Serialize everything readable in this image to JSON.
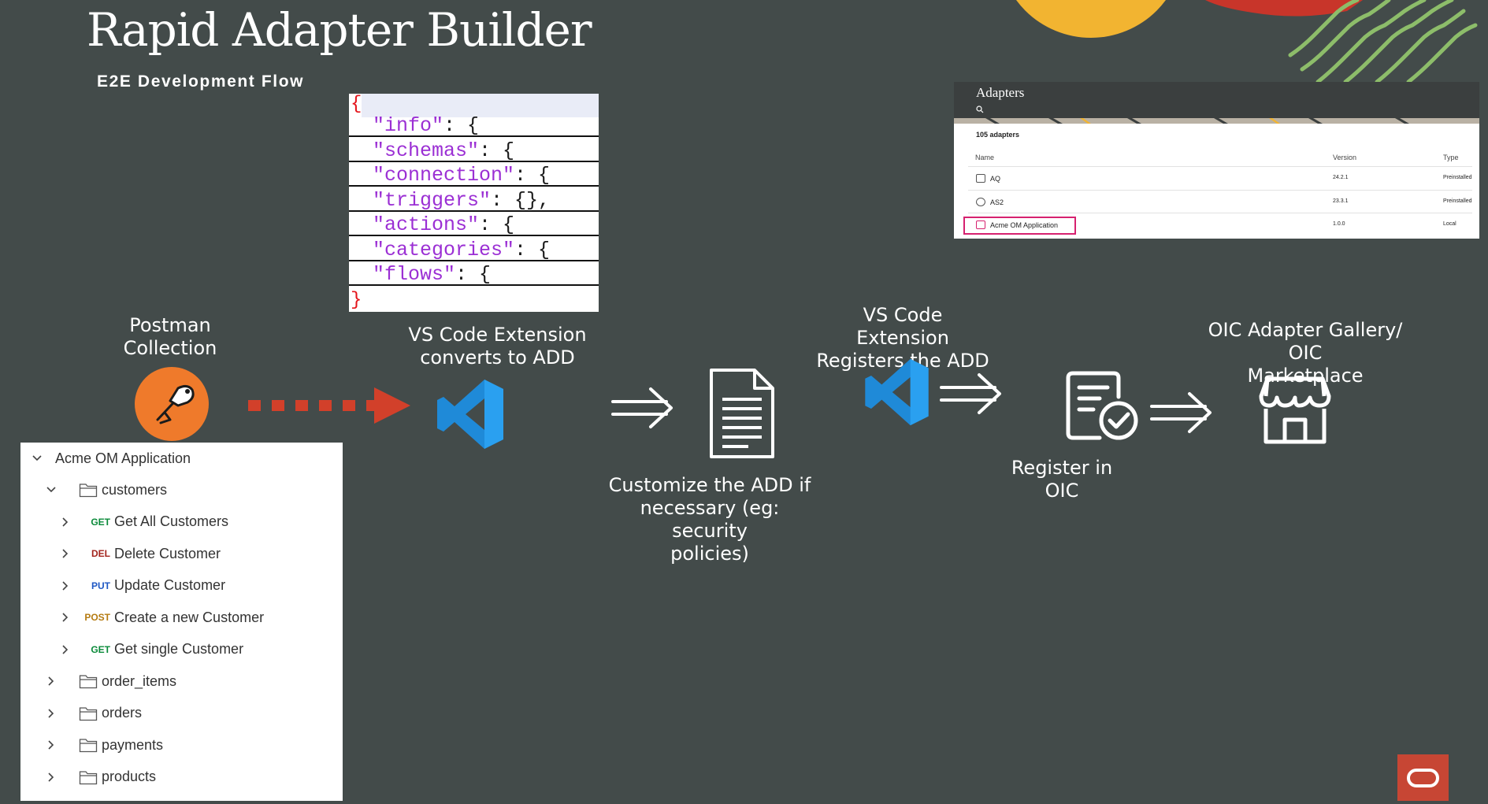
{
  "title": "Rapid Adapter Builder",
  "subtitle": "E2E Development Flow",
  "json_snippet": {
    "open_brace": "{",
    "close_brace": "}",
    "lines": [
      {
        "key": "\"info\"",
        "rest": ": {"
      },
      {
        "key": "\"schemas\"",
        "rest": ": {"
      },
      {
        "key": "\"connection\"",
        "rest": ": {"
      },
      {
        "key": "\"triggers\"",
        "rest": ": {},"
      },
      {
        "key": "\"actions\"",
        "rest": ": {"
      },
      {
        "key": "\"categories\"",
        "rest": ": {"
      },
      {
        "key": "\"flows\"",
        "rest": ": {"
      }
    ]
  },
  "steps": {
    "postman": "Postman\nCollection",
    "vscode_convert": "VS Code Extension\nconverts to ADD",
    "customize": "Customize  the ADD if\nnecessary (eg: security\npolicies)",
    "vscode_register": "VS Code Extension\nRegisters the ADD",
    "register_oic": "Register  in OIC",
    "gallery": "OIC Adapter Gallery/ OIC\nMarketplace"
  },
  "icons": {
    "postman": "postman-logo-icon",
    "vscode": "vscode-logo-icon",
    "document": "document-icon",
    "register": "certificate-check-icon",
    "store": "storefront-icon",
    "arrow": "double-arrow-icon"
  },
  "collection_tree": {
    "root": "Acme OM Application",
    "folders": [
      {
        "name": "customers",
        "expanded": true,
        "requests": [
          {
            "method": "GET",
            "name": "Get All Customers"
          },
          {
            "method": "DEL",
            "name": "Delete Customer"
          },
          {
            "method": "PUT",
            "name": "Update Customer"
          },
          {
            "method": "POST",
            "name": "Create a new Customer"
          },
          {
            "method": "GET",
            "name": "Get single Customer"
          }
        ]
      },
      {
        "name": "order_items",
        "expanded": false
      },
      {
        "name": "orders",
        "expanded": false
      },
      {
        "name": "payments",
        "expanded": false
      },
      {
        "name": "products",
        "expanded": false
      }
    ]
  },
  "method_colors": {
    "GET": "#0b8a3a",
    "DEL": "#a3241d",
    "PUT": "#1f58c4",
    "POST": "#b57b11"
  },
  "adapters_panel": {
    "heading": "Adapters",
    "count": "105 adapters",
    "columns": [
      "Name",
      "Version",
      "Type"
    ],
    "rows": [
      {
        "name": "AQ",
        "version": "24.2.1",
        "type": "Preinstalled"
      },
      {
        "name": "AS2",
        "version": "23.3.1",
        "type": "Preinstalled"
      },
      {
        "name": "Acme OM Application",
        "version": "1.0.0",
        "type": "Local",
        "highlighted": true
      }
    ]
  },
  "colors": {
    "background": "#434b4a",
    "postman_orange": "#ef7a2b",
    "vscode_blue": "#1f8ad8",
    "dotted_arrow": "#d2402a",
    "oracle_red": "#c74634",
    "highlight": "#d6216f"
  }
}
